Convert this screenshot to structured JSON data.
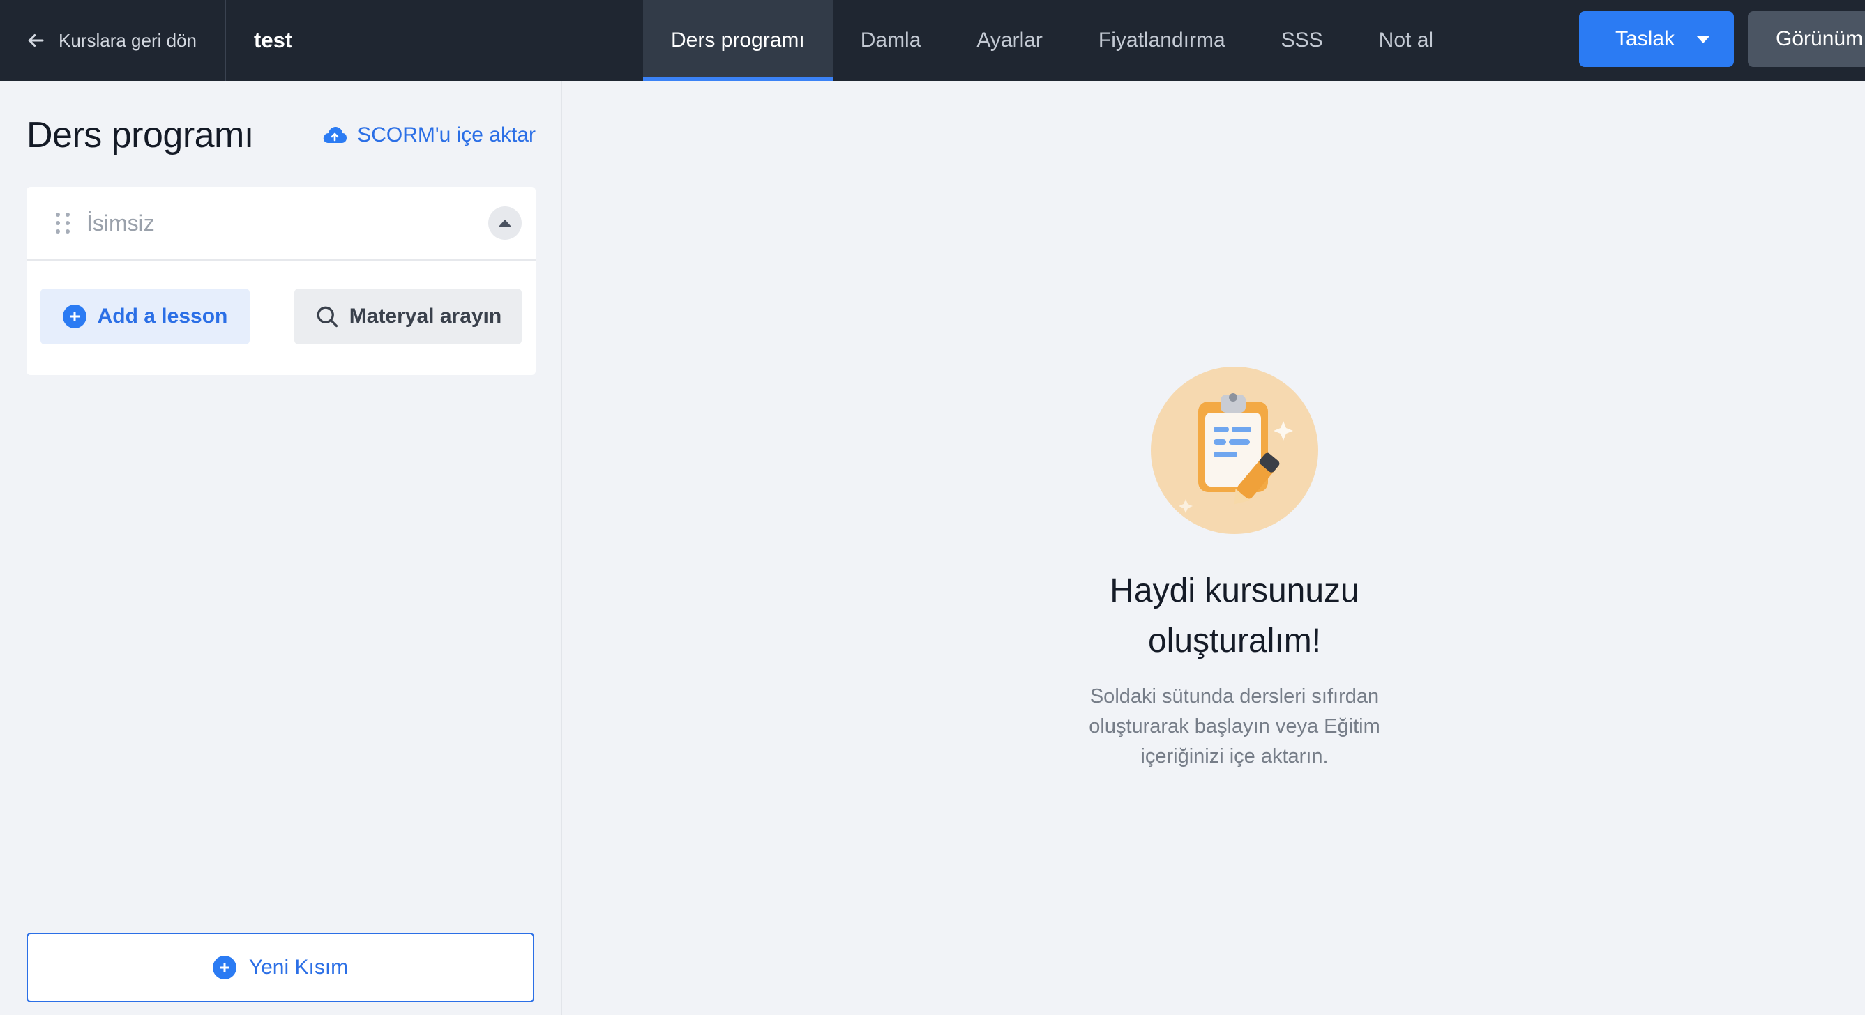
{
  "topbar": {
    "back_label": "Kurslara geri dön",
    "course_title": "test",
    "tabs": [
      {
        "label": "Ders programı",
        "active": true
      },
      {
        "label": "Damla",
        "active": false
      },
      {
        "label": "Ayarlar",
        "active": false
      },
      {
        "label": "Fiyatlandırma",
        "active": false
      },
      {
        "label": "SSS",
        "active": false
      },
      {
        "label": "Not al",
        "active": false
      }
    ],
    "status_button": "Taslak",
    "preview_button": "Görünüm"
  },
  "sidebar": {
    "title": "Ders programı",
    "import_label": "SCORM'u içe aktar",
    "section": {
      "name_placeholder": "İsimsiz",
      "add_lesson_label": "Add a lesson",
      "search_material_label": "Materyal arayın"
    },
    "new_section_label": "Yeni Kısım"
  },
  "empty_state": {
    "title": "Haydi kursunuzu oluşturalım!",
    "description": "Soldaki sütunda dersleri sıfırdan oluşturarak başlayın veya Eğitim içeriğinizi içe aktarın."
  },
  "colors": {
    "topbar": "#1f2631",
    "accent": "#2b7bf3",
    "illustration_bg": "#f6d9b0"
  }
}
